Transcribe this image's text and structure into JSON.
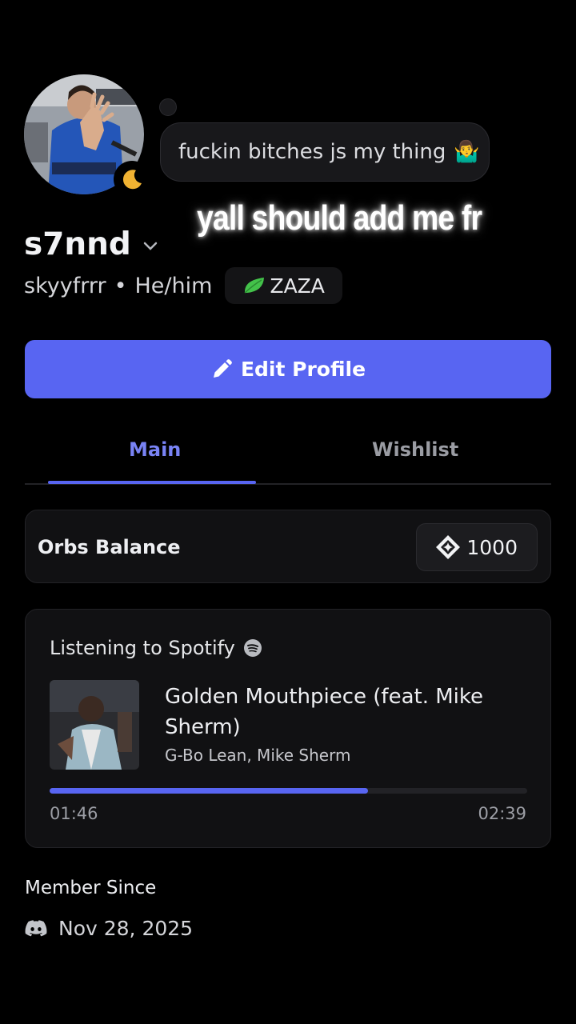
{
  "profile": {
    "display_name": "s7nnd",
    "username": "skyyfrrr",
    "separator": "•",
    "pronouns": "He/him",
    "tag_label": "ZAZA",
    "status_bubble": "fuckin bitches js my thing",
    "status_emoji": "🤷‍♂️",
    "status_icon": "moon-icon"
  },
  "caption": "yall should add me fr",
  "edit_button": {
    "label": "Edit Profile"
  },
  "tabs": [
    {
      "label": "Main",
      "active": true
    },
    {
      "label": "Wishlist",
      "active": false
    }
  ],
  "orbs": {
    "label": "Orbs Balance",
    "value": "1000"
  },
  "spotify": {
    "header": "Listening to Spotify",
    "track": "Golden Mouthpiece (feat. Mike Sherm)",
    "artist": "G-Bo Lean, Mike Sherm",
    "elapsed": "01:46",
    "duration": "02:39",
    "progress_fraction": 0.667
  },
  "member_since": {
    "title": "Member Since",
    "date": "Nov 28, 2025"
  },
  "colors": {
    "accent": "#5865f2",
    "tab_active": "#7983f5",
    "background": "#000000",
    "moon": "#f0b232"
  }
}
